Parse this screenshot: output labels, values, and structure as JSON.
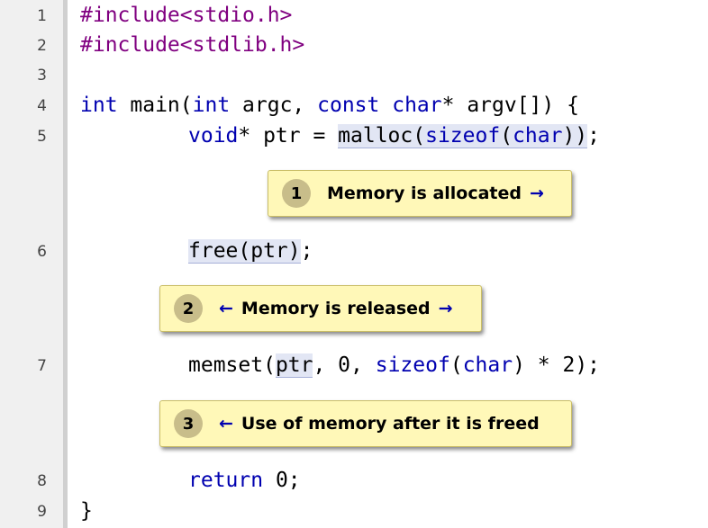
{
  "gutter": {
    "line_numbers": [
      "1",
      "2",
      "3",
      "4",
      "5",
      "6",
      "7",
      "8",
      "9"
    ]
  },
  "code": {
    "line1": {
      "include": "#include<stdio.h>"
    },
    "line2": {
      "include": "#include<stdlib.h>"
    },
    "line4": {
      "kw_int": "int",
      "main": " main(",
      "kw_int2": "int",
      "argc": " argc, ",
      "kw_const": "const",
      "space": " ",
      "kw_char": "char",
      "rest": "* argv[]) {"
    },
    "line5": {
      "kw_void": "void",
      "ptr_eq": "* ptr = ",
      "malloc": "malloc(",
      "kw_sizeof": "sizeof",
      "paren": "(",
      "kw_char": "char",
      "close": "))",
      "semi": ";"
    },
    "line6": {
      "free_call": "free(ptr)",
      "semi": ";"
    },
    "line7": {
      "memset": "memset(",
      "ptr": "ptr",
      "args": ", 0, ",
      "kw_sizeof": "sizeof",
      "paren": "(",
      "kw_char": "char",
      "rest": ") * 2);"
    },
    "line8": {
      "kw_return": "return",
      "rest": " 0;"
    },
    "line9": {
      "brace": "}"
    }
  },
  "callouts": [
    {
      "number": "1",
      "left_arrow": "",
      "text": "Memory is allocated",
      "right_arrow": "→"
    },
    {
      "number": "2",
      "left_arrow": "←",
      "text": "Memory is released",
      "right_arrow": "→"
    },
    {
      "number": "3",
      "left_arrow": "←",
      "text": "Use of memory after it is freed",
      "right_arrow": ""
    }
  ],
  "colors": {
    "preprocessor": "#800080",
    "keyword": "#0000b0",
    "callout_bg": "#fff8b8",
    "badge_bg": "#c8bd8a",
    "highlight_bg": "#e2e6f4"
  }
}
